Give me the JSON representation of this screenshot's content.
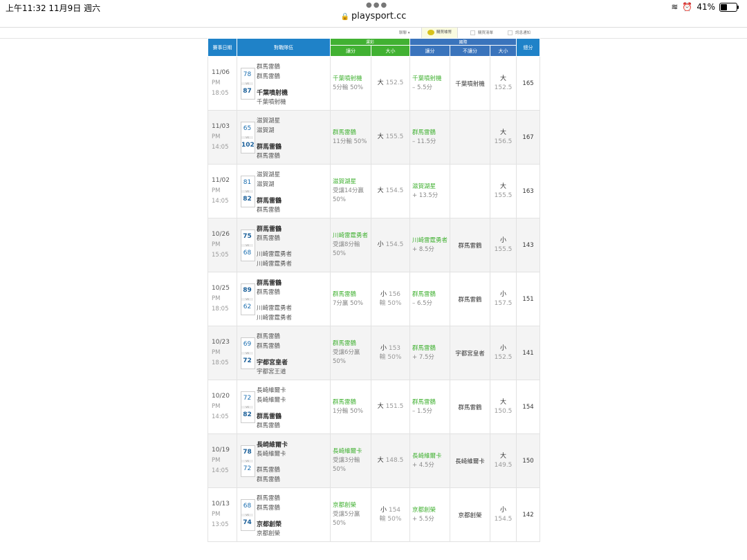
{
  "status": {
    "time": "上午11:32   11月9日 週六",
    "battery": "41%",
    "battery_level": 0.41
  },
  "url": "playsport.cc",
  "toolbar": {
    "item1": "聊聊 ▾",
    "item2": "購買噱幣",
    "item3": "購買清單",
    "item4": "訊息通知"
  },
  "table": {
    "headers": {
      "date": "賽事日期",
      "teams": "對戰隊伍",
      "group1": "運彩",
      "group2": "國際",
      "total": "總分",
      "g1_spread": "讓分",
      "g1_ou": "大小",
      "g2_spread": "讓分",
      "g2_nospread": "不讓分",
      "g2_ou": "大小"
    },
    "rows": [
      {
        "date": "11/06",
        "ampm": "PM",
        "clock": "18:05",
        "away_full": "群馬雷鶴",
        "away": "群馬雷鶴",
        "home": "千葉噴射機",
        "home_full": "千葉噴射機",
        "away_score": "78",
        "home_score": "87",
        "winner": "home",
        "ts_pick": "千葉噴射機",
        "ts_result": "5分輸 50%",
        "ts_ou": "大",
        "ts_ou_val": "152.5",
        "ts_ou_result": "",
        "intl_pick": "千葉噴射機",
        "intl_line": "– 5.5分",
        "intl_ml": "千葉噴射機",
        "intl_ou": "大",
        "intl_ou_val": "152.5",
        "total": "165"
      },
      {
        "date": "11/03",
        "ampm": "PM",
        "clock": "14:05",
        "away_full": "滋賀湖星",
        "away": "滋賀湖",
        "home": "群馬雷鶴",
        "home_full": "群馬雷鶴",
        "away_score": "65",
        "home_score": "102",
        "winner": "home",
        "ts_pick": "群馬雷鶴",
        "ts_result": "11分輸 50%",
        "ts_ou": "大",
        "ts_ou_val": "155.5",
        "ts_ou_result": "",
        "intl_pick": "群馬雷鶴",
        "intl_line": "– 11.5分",
        "intl_ml": "",
        "intl_ou": "大",
        "intl_ou_val": "156.5",
        "total": "167"
      },
      {
        "date": "11/02",
        "ampm": "PM",
        "clock": "14:05",
        "away_full": "滋賀湖星",
        "away": "滋賀湖",
        "home": "群馬雷鶴",
        "home_full": "群馬雷鶴",
        "away_score": "81",
        "home_score": "82",
        "winner": "home",
        "ts_pick": "滋賀湖星",
        "ts_result": "受讓14分贏 50%",
        "ts_ou": "大",
        "ts_ou_val": "154.5",
        "ts_ou_result": "",
        "intl_pick": "滋賀湖星",
        "intl_line": "+ 13.5分",
        "intl_ml": "",
        "intl_ou": "大",
        "intl_ou_val": "155.5",
        "total": "163"
      },
      {
        "date": "10/26",
        "ampm": "PM",
        "clock": "15:05",
        "away_full": "群馬雷鶴",
        "away": "群馬雷鶴",
        "home": "川崎雷霆勇者",
        "home_full": "川崎雷霆勇者",
        "away_score": "75",
        "home_score": "68",
        "winner": "away",
        "ts_pick": "川崎雷霆勇者",
        "ts_result": "受讓8分輸 50%",
        "ts_ou": "小",
        "ts_ou_val": "154.5",
        "ts_ou_result": "",
        "intl_pick": "川崎雷霆勇者",
        "intl_line": "+ 8.5分",
        "intl_ml": "群馬雷鶴",
        "intl_ou": "小",
        "intl_ou_val": "155.5",
        "total": "143"
      },
      {
        "date": "10/25",
        "ampm": "PM",
        "clock": "18:05",
        "away_full": "群馬雷鶴",
        "away": "群馬雷鶴",
        "home": "川崎雷霆勇者",
        "home_full": "川崎雷霆勇者",
        "away_score": "89",
        "home_score": "62",
        "winner": "away",
        "ts_pick": "群馬雷鶴",
        "ts_result": "7分贏 50%",
        "ts_ou": "小",
        "ts_ou_val": "156",
        "ts_ou_result": "輸 50%",
        "intl_pick": "群馬雷鶴",
        "intl_line": "– 6.5分",
        "intl_ml": "群馬雷鶴",
        "intl_ou": "小",
        "intl_ou_val": "157.5",
        "total": "151"
      },
      {
        "date": "10/23",
        "ampm": "PM",
        "clock": "18:05",
        "away_full": "群馬雷鶴",
        "away": "群馬雷鶴",
        "home": "宇都宮皇者",
        "home_full": "宇都宮王道",
        "away_score": "69",
        "home_score": "72",
        "winner": "home",
        "ts_pick": "群馬雷鶴",
        "ts_result": "受讓6分贏 50%",
        "ts_ou": "小",
        "ts_ou_val": "153",
        "ts_ou_result": "輸 50%",
        "intl_pick": "群馬雷鶴",
        "intl_line": "+ 7.5分",
        "intl_ml": "宇都宮皇者",
        "intl_ou": "小",
        "intl_ou_val": "152.5",
        "total": "141"
      },
      {
        "date": "10/20",
        "ampm": "PM",
        "clock": "14:05",
        "away_full": "長崎維爾卡",
        "away": "長崎維爾卡",
        "home": "群馬雷鶴",
        "home_full": "群馬雷鶴",
        "away_score": "72",
        "home_score": "82",
        "winner": "home",
        "ts_pick": "群馬雷鶴",
        "ts_result": "1分輸 50%",
        "ts_ou": "大",
        "ts_ou_val": "151.5",
        "ts_ou_result": "",
        "intl_pick": "群馬雷鶴",
        "intl_line": "– 1.5分",
        "intl_ml": "群馬雷鶴",
        "intl_ou": "大",
        "intl_ou_val": "150.5",
        "total": "154"
      },
      {
        "date": "10/19",
        "ampm": "PM",
        "clock": "14:05",
        "away_full": "長崎維爾卡",
        "away": "長崎維爾卡",
        "home": "群馬雷鶴",
        "home_full": "群馬雷鶴",
        "away_score": "78",
        "home_score": "72",
        "winner": "away",
        "ts_pick": "長崎維爾卡",
        "ts_result": "受讓3分輸 50%",
        "ts_ou": "大",
        "ts_ou_val": "148.5",
        "ts_ou_result": "",
        "intl_pick": "長崎維爾卡",
        "intl_line": "+ 4.5分",
        "intl_ml": "長崎維爾卡",
        "intl_ou": "大",
        "intl_ou_val": "149.5",
        "total": "150"
      },
      {
        "date": "10/13",
        "ampm": "PM",
        "clock": "13:05",
        "away_full": "群馬雷鶴",
        "away": "群馬雷鶴",
        "home": "京都創榮",
        "home_full": "京都創榮",
        "away_score": "68",
        "home_score": "74",
        "winner": "home",
        "ts_pick": "京都創榮",
        "ts_result": "受讓5分贏 50%",
        "ts_ou": "小",
        "ts_ou_val": "154",
        "ts_ou_result": "輸 50%",
        "intl_pick": "京都創榮",
        "intl_line": "+ 5.5分",
        "intl_ml": "京都創榮",
        "intl_ou": "小",
        "intl_ou_val": "154.5",
        "total": "142"
      }
    ]
  }
}
